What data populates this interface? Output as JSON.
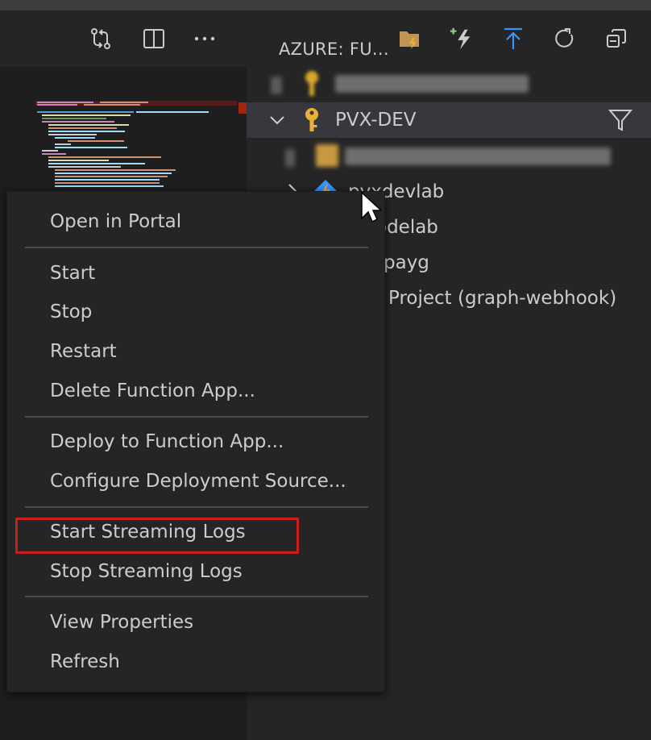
{
  "toolbar": {
    "panel_title": "AZURE: FU...",
    "icons": [
      "compare-changes-icon",
      "split-editor-icon",
      "more-actions-icon",
      "open-folder-icon",
      "create-function-icon",
      "deploy-icon",
      "refresh-icon",
      "collapse-all-icon"
    ],
    "accent_blue": "#3794ff",
    "accent_green": "#89d185",
    "accent_yellow": "#e8b036"
  },
  "explorer": {
    "subscription_label": "PVX-DEV",
    "items": [
      {
        "label": "pvxdevlab"
      },
      {
        "label": "odelab"
      },
      {
        "label": "payg"
      },
      {
        "label": "Project (graph-webhook)"
      }
    ]
  },
  "context_menu": {
    "groups": [
      [
        "Open in Portal"
      ],
      [
        "Start",
        "Stop",
        "Restart",
        "Delete Function App..."
      ],
      [
        "Deploy to Function App...",
        "Configure Deployment Source..."
      ],
      [
        "Start Streaming Logs",
        "Stop Streaming Logs"
      ],
      [
        "View Properties",
        "Refresh"
      ]
    ],
    "highlighted_item": "Start Streaming Logs",
    "highlight_color": "#c81e1e"
  }
}
